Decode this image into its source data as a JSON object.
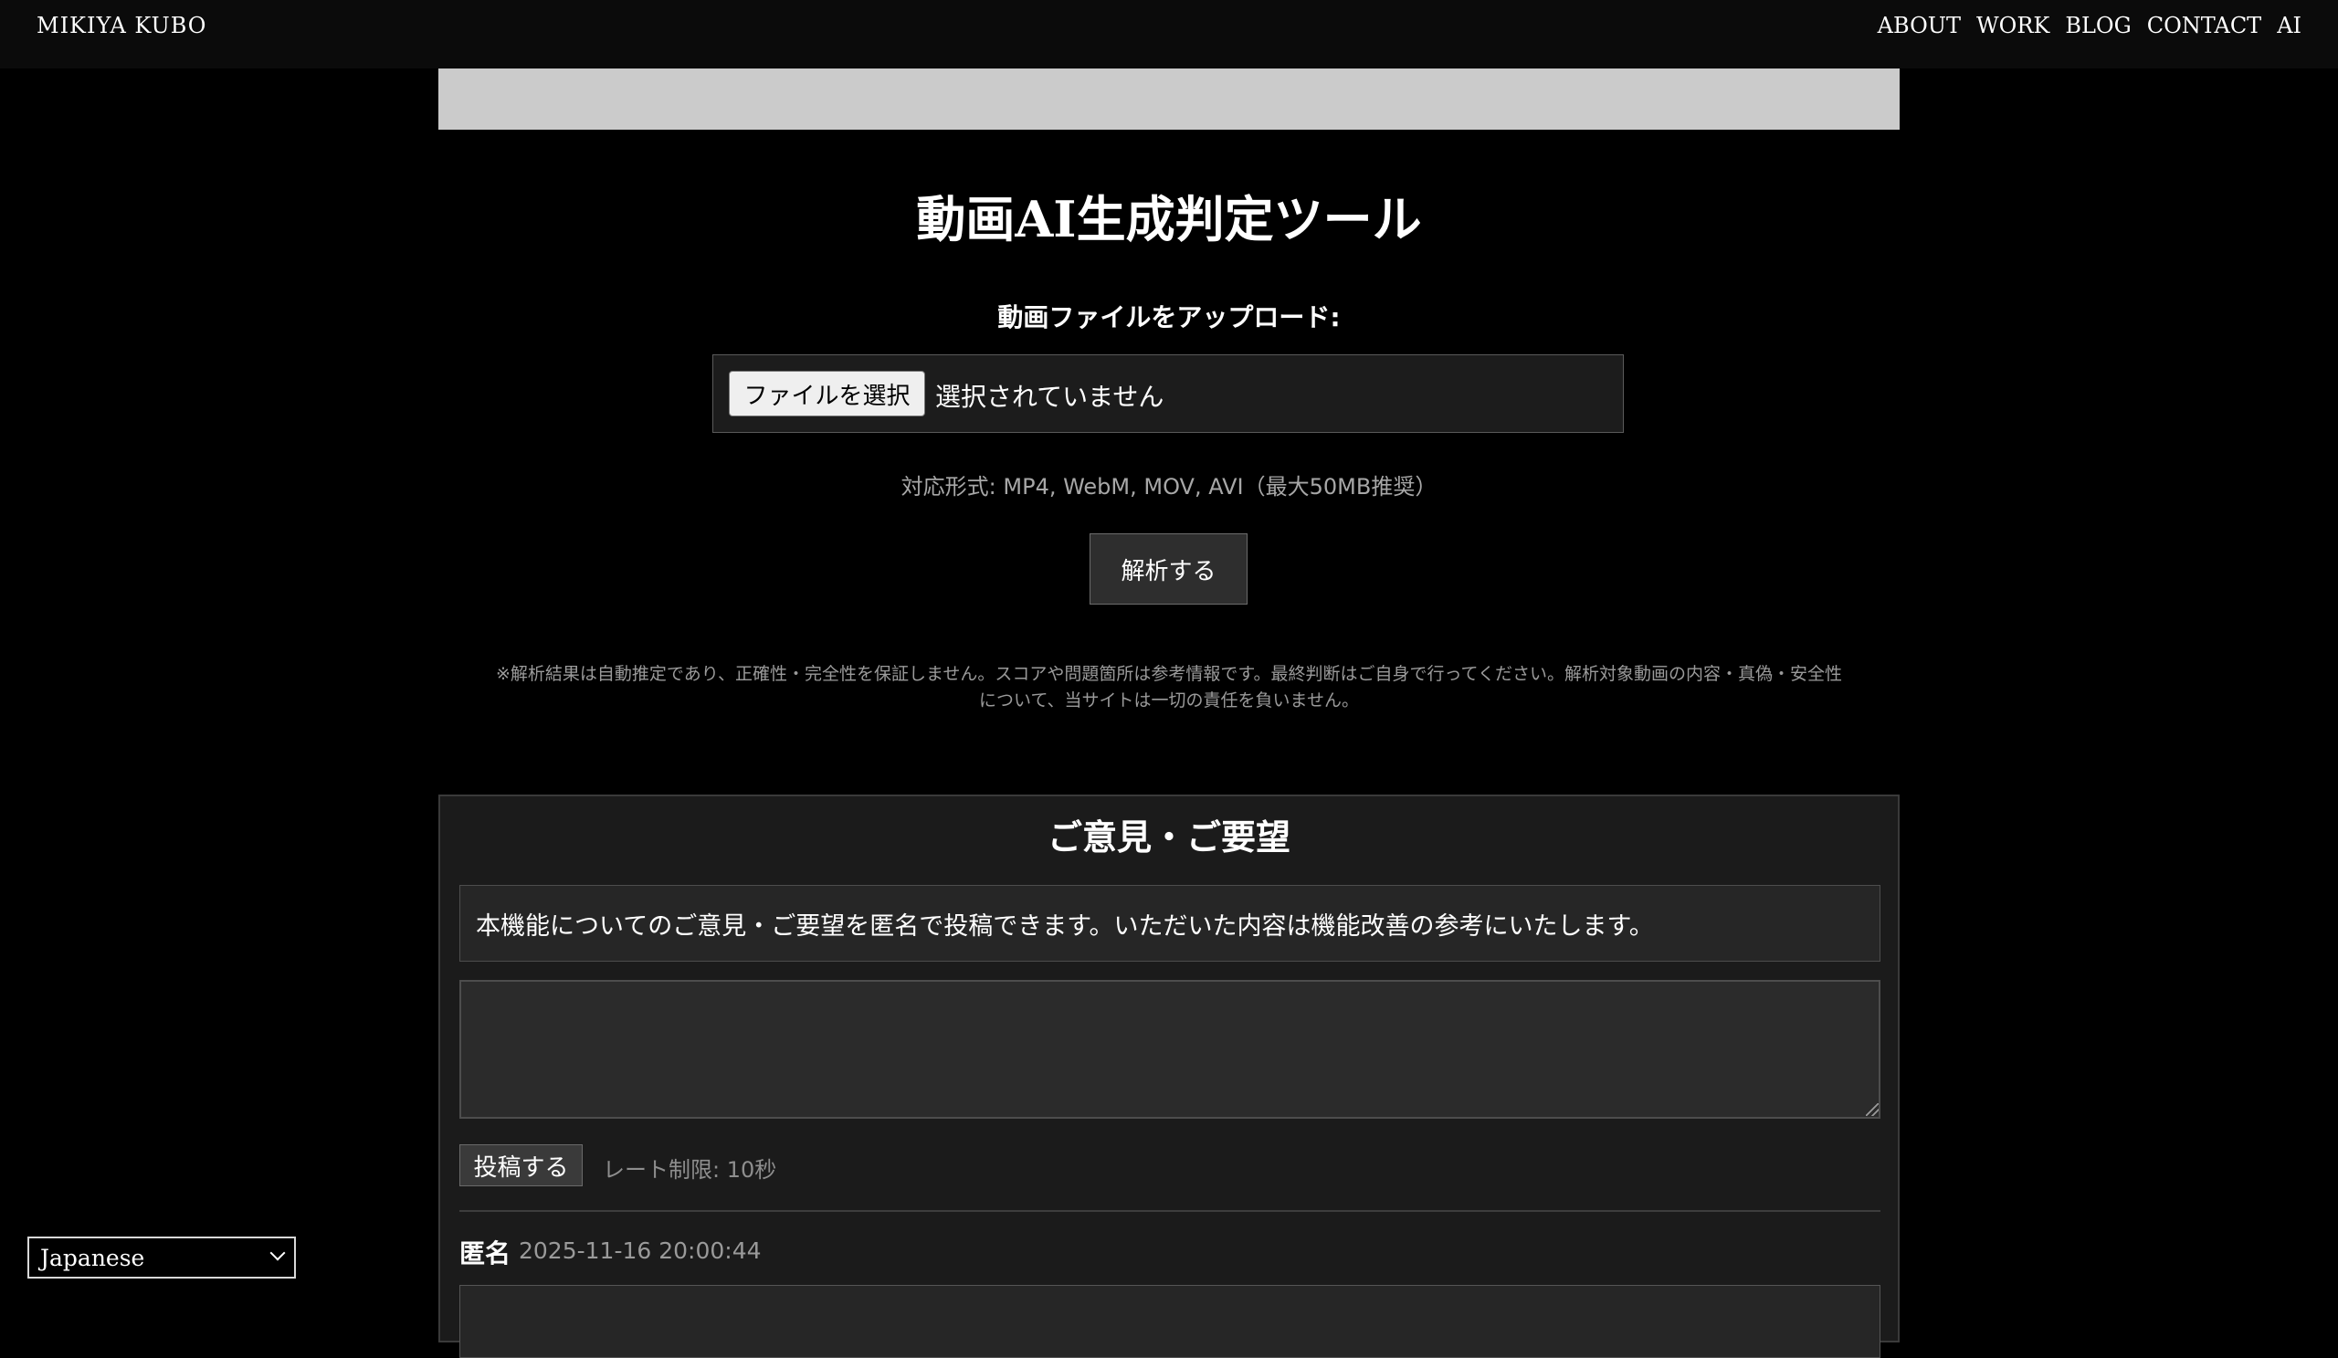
{
  "header": {
    "brand": "MIKIYA KUBO",
    "nav": [
      "ABOUT",
      "WORK",
      "BLOG",
      "CONTACT",
      "AI"
    ]
  },
  "tool": {
    "title": "動画AI生成判定ツール",
    "upload_label": "動画ファイルをアップロード:",
    "file_button": "ファイルを選択",
    "file_status": "選択されていません",
    "formats": "対応形式: MP4, WebM, MOV, AVI（最大50MB推奨）",
    "analyze_button": "解析する",
    "disclaimer_line1": "※解析結果は自動推定であり、正確性・完全性を保証しません。スコアや問題箇所は参考情報です。最終判断はご自身で行ってください。解析対象動画の内容・真偽・安全性",
    "disclaimer_line2": "について、当サイトは一切の責任を負いません。"
  },
  "feedback": {
    "title": "ご意見・ご要望",
    "description": "本機能についてのご意見・ご要望を匿名で投稿できます。いただいた内容は機能改善の参考にいたします。",
    "textarea_value": "",
    "post_button": "投稿する",
    "rate_limit": "レート制限: 10秒",
    "entries": [
      {
        "author": "匿名",
        "date": "2025-11-16 20:00:44"
      }
    ]
  },
  "language": {
    "selected": "Japanese"
  },
  "colors": {
    "background": "#000000",
    "header_bg": "#0b0b0b",
    "banner": "#cbcbcb",
    "panel_bg": "#1b1b1b"
  }
}
